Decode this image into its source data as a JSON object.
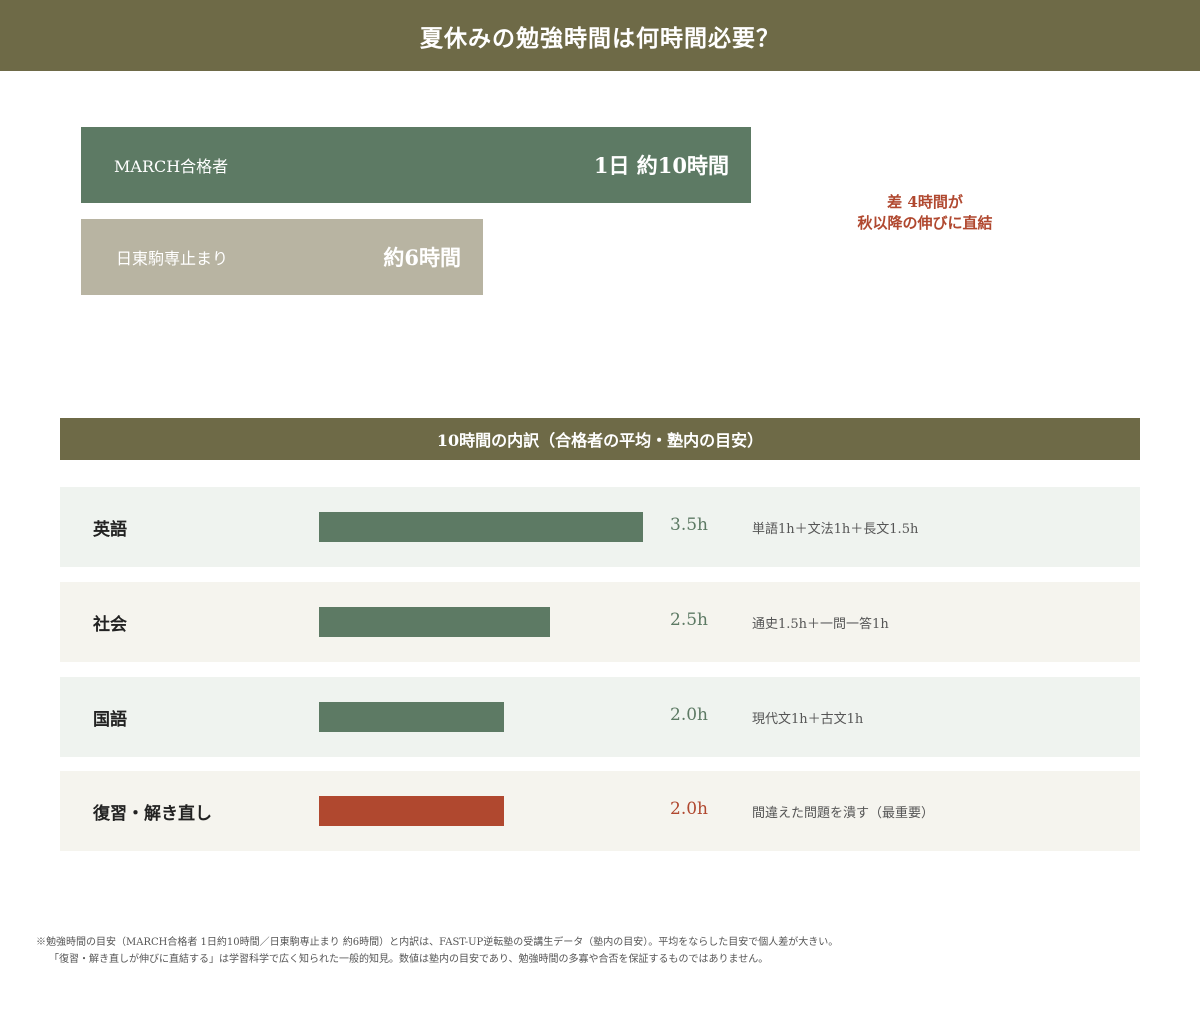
{
  "header": {
    "title": "夏休みの勉強時間は何時間必要？"
  },
  "comparison": [
    {
      "label": "MARCH合格者",
      "value_text": "1日 約10時間",
      "hours": 10,
      "color": "#5d7a64"
    },
    {
      "label": "日東駒専止まり",
      "value_text": "約6時間",
      "hours": 6,
      "color": "#b8b4a2"
    }
  ],
  "diff_note": {
    "line1": "差 4時間が",
    "line2": "秋以降の伸びに直結"
  },
  "chart_data": {
    "type": "bar",
    "title": "10時間の内訳（合格者の平均・塾内の目安）",
    "categories": [
      "英語",
      "社会",
      "国語",
      "復習・解き直し"
    ],
    "values": [
      3.5,
      2.5,
      2.0,
      2.0
    ],
    "value_labels": [
      "3.5h",
      "2.5h",
      "2.0h",
      "2.0h"
    ],
    "details": [
      "単語1h＋文法1h＋長文1.5h",
      "通史1.5h＋一問一答1h",
      "現代文1h＋古文1h",
      "間違えた問題を潰す（最重要）"
    ],
    "bar_colors": [
      "#5d7a64",
      "#5d7a64",
      "#5d7a64",
      "#b0482f"
    ],
    "value_colors": [
      "#5d7a64",
      "#5d7a64",
      "#5d7a64",
      "#b0482f"
    ],
    "xlim": [
      0,
      3.5
    ]
  },
  "footnote": {
    "line1": "※勉強時間の目安（MARCH合格者 1日約10時間／日東駒専止まり 約6時間）と内訳は、FAST-UP逆転塾の受講生データ（塾内の目安）。平均をならした目安で個人差が大きい。",
    "line2": "「復習・解き直しが伸びに直結する」は学習科学で広く知られた一般的知見。数値は塾内の目安であり、勉強時間の多寡や合否を保証するものではありません。"
  }
}
